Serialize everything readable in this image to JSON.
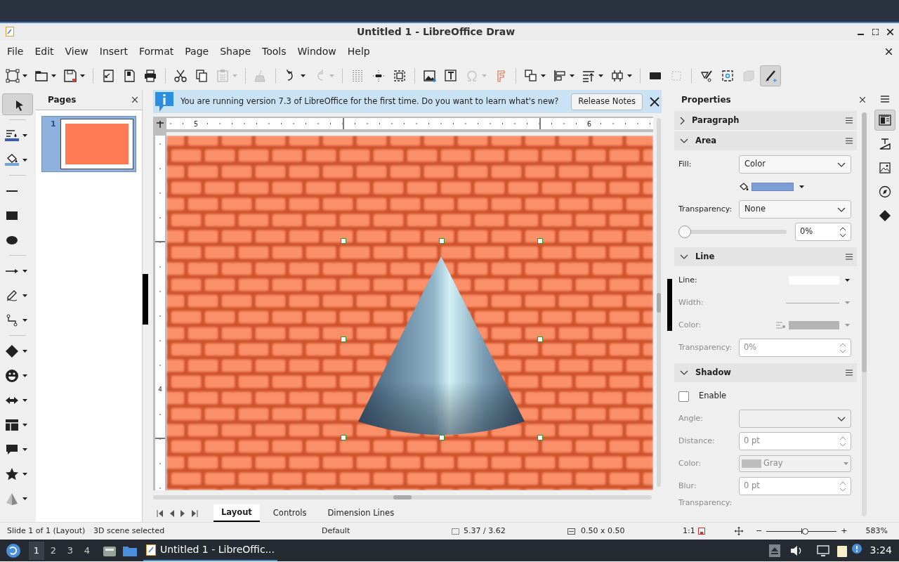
{
  "window": {
    "title": "Untitled 1 - LibreOffice Draw"
  },
  "menu": [
    "File",
    "Edit",
    "View",
    "Insert",
    "Format",
    "Page",
    "Shape",
    "Tools",
    "Window",
    "Help"
  ],
  "toolbar": [
    {
      "kind": "button",
      "dropdown": true,
      "disabled": false,
      "selected": false
    },
    {
      "kind": "button",
      "dropdown": true,
      "disabled": false,
      "selected": false
    },
    {
      "kind": "button",
      "dropdown": true,
      "disabled": false,
      "selected": false
    },
    {
      "kind": "separator"
    },
    {
      "kind": "button",
      "dropdown": false,
      "disabled": false,
      "selected": false
    },
    {
      "kind": "button",
      "dropdown": false,
      "disabled": false,
      "selected": false
    },
    {
      "kind": "button",
      "dropdown": false,
      "disabled": false,
      "selected": false
    },
    {
      "kind": "separator"
    },
    {
      "kind": "button",
      "dropdown": false,
      "disabled": false,
      "selected": false
    },
    {
      "kind": "button",
      "dropdown": false,
      "disabled": false,
      "selected": false
    },
    {
      "kind": "button",
      "dropdown": true,
      "disabled": true,
      "selected": false
    },
    {
      "kind": "separator"
    },
    {
      "kind": "button",
      "dropdown": false,
      "disabled": true,
      "selected": false
    },
    {
      "kind": "separator"
    },
    {
      "kind": "button",
      "dropdown": true,
      "disabled": false,
      "selected": false
    },
    {
      "kind": "button",
      "dropdown": true,
      "disabled": true,
      "selected": false
    },
    {
      "kind": "separator"
    },
    {
      "kind": "button",
      "dropdown": false,
      "disabled": false,
      "selected": false
    },
    {
      "kind": "button",
      "dropdown": false,
      "disabled": false,
      "selected": false
    },
    {
      "kind": "button",
      "dropdown": false,
      "disabled": false,
      "selected": false
    },
    {
      "kind": "separator"
    },
    {
      "kind": "button",
      "dropdown": false,
      "disabled": false,
      "selected": false
    },
    {
      "kind": "button",
      "dropdown": false,
      "disabled": false,
      "selected": false
    },
    {
      "kind": "button",
      "dropdown": true,
      "disabled": true,
      "selected": false
    },
    {
      "kind": "button",
      "dropdown": false,
      "disabled": false,
      "selected": false
    },
    {
      "kind": "separator"
    },
    {
      "kind": "button",
      "dropdown": true,
      "disabled": false,
      "selected": false
    },
    {
      "kind": "button",
      "dropdown": true,
      "disabled": false,
      "selected": false
    },
    {
      "kind": "button",
      "dropdown": true,
      "disabled": false,
      "selected": false
    },
    {
      "kind": "button",
      "dropdown": true,
      "disabled": false,
      "selected": false
    },
    {
      "kind": "separator"
    },
    {
      "kind": "button",
      "dropdown": false,
      "disabled": false,
      "selected": false
    },
    {
      "kind": "button",
      "dropdown": false,
      "disabled": true,
      "selected": false
    },
    {
      "kind": "separator"
    },
    {
      "kind": "button",
      "dropdown": false,
      "disabled": false,
      "selected": false
    },
    {
      "kind": "button",
      "dropdown": false,
      "disabled": false,
      "selected": false
    },
    {
      "kind": "button",
      "dropdown": false,
      "disabled": true,
      "selected": false
    },
    {
      "kind": "button",
      "dropdown": false,
      "disabled": false,
      "selected": true
    }
  ],
  "drawing_tools": [
    {
      "kind": "button",
      "dropdown": false,
      "selected": true
    },
    {
      "kind": "separator"
    },
    {
      "kind": "button",
      "dropdown": true,
      "selected": false
    },
    {
      "kind": "button",
      "dropdown": true,
      "selected": false
    },
    {
      "kind": "separator"
    },
    {
      "kind": "button",
      "dropdown": false,
      "selected": false
    },
    {
      "kind": "button",
      "dropdown": false,
      "selected": false
    },
    {
      "kind": "button",
      "dropdown": false,
      "selected": false
    },
    {
      "kind": "separator"
    },
    {
      "kind": "button",
      "dropdown": true,
      "selected": false
    },
    {
      "kind": "button",
      "dropdown": true,
      "selected": false
    },
    {
      "kind": "button",
      "dropdown": true,
      "selected": false
    },
    {
      "kind": "separator"
    },
    {
      "kind": "button",
      "dropdown": true,
      "selected": false
    },
    {
      "kind": "button",
      "dropdown": true,
      "selected": false
    },
    {
      "kind": "button",
      "dropdown": true,
      "selected": false
    },
    {
      "kind": "button",
      "dropdown": true,
      "selected": false
    },
    {
      "kind": "button",
      "dropdown": true,
      "selected": false
    },
    {
      "kind": "button",
      "dropdown": true,
      "selected": false
    },
    {
      "kind": "button",
      "dropdown": true,
      "selected": false
    }
  ],
  "pages_panel": {
    "title": "Pages",
    "pages": [
      {
        "number": "1",
        "selected": true
      }
    ]
  },
  "infobar": {
    "message": "You are running version 7.3 of LibreOffice for the first time. Do you want to learn what's new?",
    "button": "Release Notes"
  },
  "ruler": {
    "horizontal_labels": [
      "5",
      "6"
    ],
    "vertical_labels": [
      "4"
    ]
  },
  "layer_tabs": [
    {
      "label": "Layout",
      "selected": true
    },
    {
      "label": "Controls",
      "selected": false
    },
    {
      "label": "Dimension Lines",
      "selected": false
    }
  ],
  "properties": {
    "title": "Properties",
    "sections": [
      {
        "title": "Paragraph",
        "expanded": false
      },
      {
        "title": "Area",
        "expanded": true,
        "rows": [
          {
            "kind": "dropdown",
            "label": "Fill:",
            "value": "Color",
            "disabled": false
          },
          {
            "kind": "color",
            "color": "#7b9fd4"
          },
          {
            "kind": "dropdown",
            "label": "Transparency:",
            "value": "None",
            "disabled": false
          },
          {
            "kind": "slider",
            "level": 0,
            "value": "0%"
          }
        ]
      },
      {
        "title": "Line",
        "expanded": true,
        "rows": [
          {
            "kind": "line_swatch",
            "label": "Line:",
            "color": "#ffffff",
            "disabled": false
          },
          {
            "kind": "line_width",
            "label": "Width:",
            "disabled": true
          },
          {
            "kind": "line_color",
            "label": "Color:",
            "color": "#b4b4b4",
            "disabled": true
          },
          {
            "kind": "spin",
            "label": "Transparency:",
            "value": "0%",
            "disabled": true
          }
        ]
      },
      {
        "title": "Shadow",
        "expanded": true,
        "rows": [
          {
            "kind": "checkbox",
            "label": "Enable",
            "checked": false
          },
          {
            "kind": "dropdown",
            "label": "Angle:",
            "value": "",
            "disabled": true
          },
          {
            "kind": "spin",
            "label": "Distance:",
            "value": "0 pt",
            "disabled": true
          },
          {
            "kind": "color_dropdown",
            "label": "Color:",
            "value": "Gray",
            "color": "#bdbdbd",
            "disabled": true
          },
          {
            "kind": "spin",
            "label": "Blur:",
            "value": "0 pt",
            "disabled": true
          },
          {
            "kind": "label",
            "label": "Transparency:",
            "disabled": true
          }
        ]
      }
    ]
  },
  "sidebar_tabs": [
    {
      "selected": true
    },
    {
      "selected": false
    },
    {
      "selected": false
    },
    {
      "selected": false
    },
    {
      "selected": false
    }
  ],
  "status_bar": {
    "slide": "Slide 1 of 1 (Layout)",
    "selection": "3D scene selected",
    "layout": "Default",
    "position": "5.37 / 3.62",
    "size": "0.50 x 0.50",
    "scale": "1:1",
    "zoom_out": "−",
    "zoom_slider": {
      "level": 0.55
    },
    "zoom_in": "+",
    "zoom": "583%"
  },
  "taskbar": {
    "workspaces": [
      {
        "label": "1",
        "selected": true
      },
      {
        "label": "2",
        "selected": false
      },
      {
        "label": "3",
        "selected": false
      },
      {
        "label": "4",
        "selected": false
      }
    ],
    "task": "Untitled 1 - LibreOffic...",
    "clock": "3:24"
  }
}
